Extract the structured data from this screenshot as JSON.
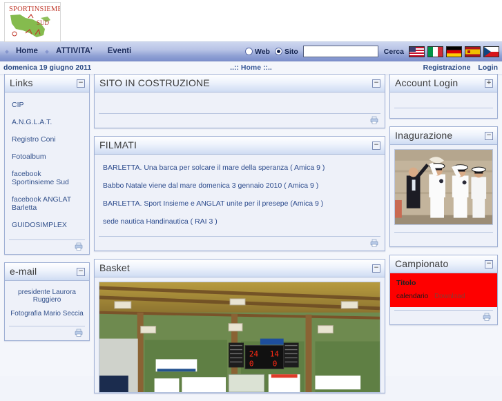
{
  "site": {
    "logo_line1": "SPORTINSIEME",
    "logo_line2": "SUD"
  },
  "nav": {
    "items": [
      {
        "label": "Home"
      },
      {
        "label": "ATTIVITA'"
      },
      {
        "label": "Eventi"
      }
    ],
    "search": {
      "radio_web": "Web",
      "radio_sito": "Sito",
      "selected": "Sito",
      "value": "",
      "cerca_label": "Cerca"
    },
    "flags": [
      {
        "name": "flag-usa"
      },
      {
        "name": "flag-italy"
      },
      {
        "name": "flag-germany"
      },
      {
        "name": "flag-spain"
      },
      {
        "name": "flag-czech"
      }
    ]
  },
  "datebar": {
    "date": "domenica 19 giugno 2011",
    "breadcrumb": "..:: Home ::..",
    "registrazione": "Registrazione",
    "login": "Login"
  },
  "left": {
    "links_panel": {
      "title": "Links",
      "toggle": "−",
      "items": [
        {
          "label": "CIP"
        },
        {
          "label": "A.N.G.L.A.T."
        },
        {
          "label": "Registro Coni"
        },
        {
          "label": "Fotoalbum"
        },
        {
          "label": "facebook Sportinsieme Sud"
        },
        {
          "label": "facebook ANGLAT Barletta"
        },
        {
          "label": "GUIDOSIMPLEX"
        }
      ]
    },
    "email_panel": {
      "title": "e-mail",
      "toggle": "−",
      "items": [
        {
          "label": "presidente Laurora Ruggiero"
        },
        {
          "label": "Fotografia Mario Seccia"
        }
      ]
    }
  },
  "center": {
    "costruzione_panel": {
      "title": "SITO IN COSTRUZIONE",
      "toggle": "−"
    },
    "filmati_panel": {
      "title": "FILMATI",
      "toggle": "−",
      "items": [
        {
          "label": "BARLETTA. Una barca per solcare il mare della speranza ( Amica 9 )"
        },
        {
          "label": "Babbo Natale viene dal mare domenica 3 gennaio 2010 ( Amica 9 )"
        },
        {
          "label": "BARLETTA. Sport Insieme e ANGLAT unite per il presepe (Amica 9 )"
        },
        {
          "label": "sede nautica Handinautica ( RAI 3 )"
        }
      ]
    },
    "basket_panel": {
      "title": "Basket",
      "toggle": "−",
      "image_alt": "palestra-basket-photo"
    }
  },
  "right": {
    "account_panel": {
      "title": "Account Login",
      "toggle": "+"
    },
    "inagurazione_panel": {
      "title": "Inagurazione",
      "toggle": "−",
      "image_alt": "inaugurazione-photo"
    },
    "campionato_panel": {
      "title": "Campionato",
      "toggle": "−",
      "titolo": "Titolo",
      "row_label": "calendario",
      "download": "Download"
    }
  },
  "colors": {
    "nav_blue": "#8fa0d4",
    "panel_border": "#9fb0d4",
    "red_block": "#fe0000",
    "link": "#34528c"
  }
}
